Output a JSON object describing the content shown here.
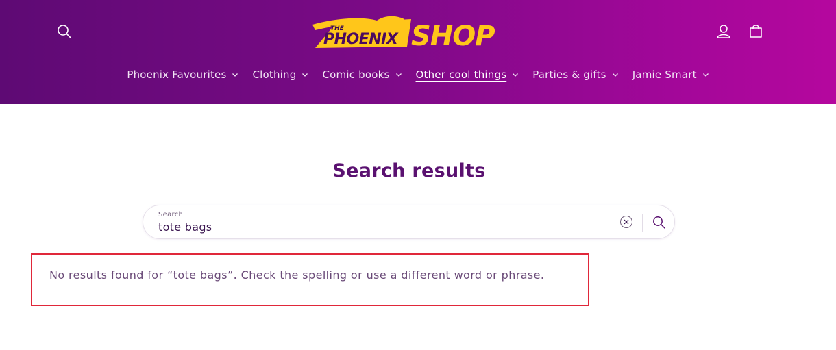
{
  "header": {
    "logo": {
      "small_text": "THE",
      "brand_text": "PHOENIX",
      "shop_text": "SHOP"
    },
    "icons": {
      "search": "search-icon",
      "account": "account-icon",
      "cart": "cart-icon"
    }
  },
  "nav": {
    "items": [
      {
        "label": "Phoenix Favourites",
        "active": false
      },
      {
        "label": "Clothing",
        "active": false
      },
      {
        "label": "Comic books",
        "active": false
      },
      {
        "label": "Other cool things",
        "active": true
      },
      {
        "label": "Parties & gifts",
        "active": false
      },
      {
        "label": "Jamie Smart",
        "active": false
      }
    ]
  },
  "main": {
    "title": "Search results",
    "search": {
      "label": "Search",
      "value": "tote bags"
    },
    "no_results_message": "No results found for “tote bags”. Check the spelling or use a different word or phrase."
  },
  "colors": {
    "header_gradient_start": "#5e0a74",
    "header_gradient_end": "#b5079e",
    "title": "#5a1170",
    "highlight_border": "#e0283a",
    "logo_yellow": "#ffc61a"
  }
}
